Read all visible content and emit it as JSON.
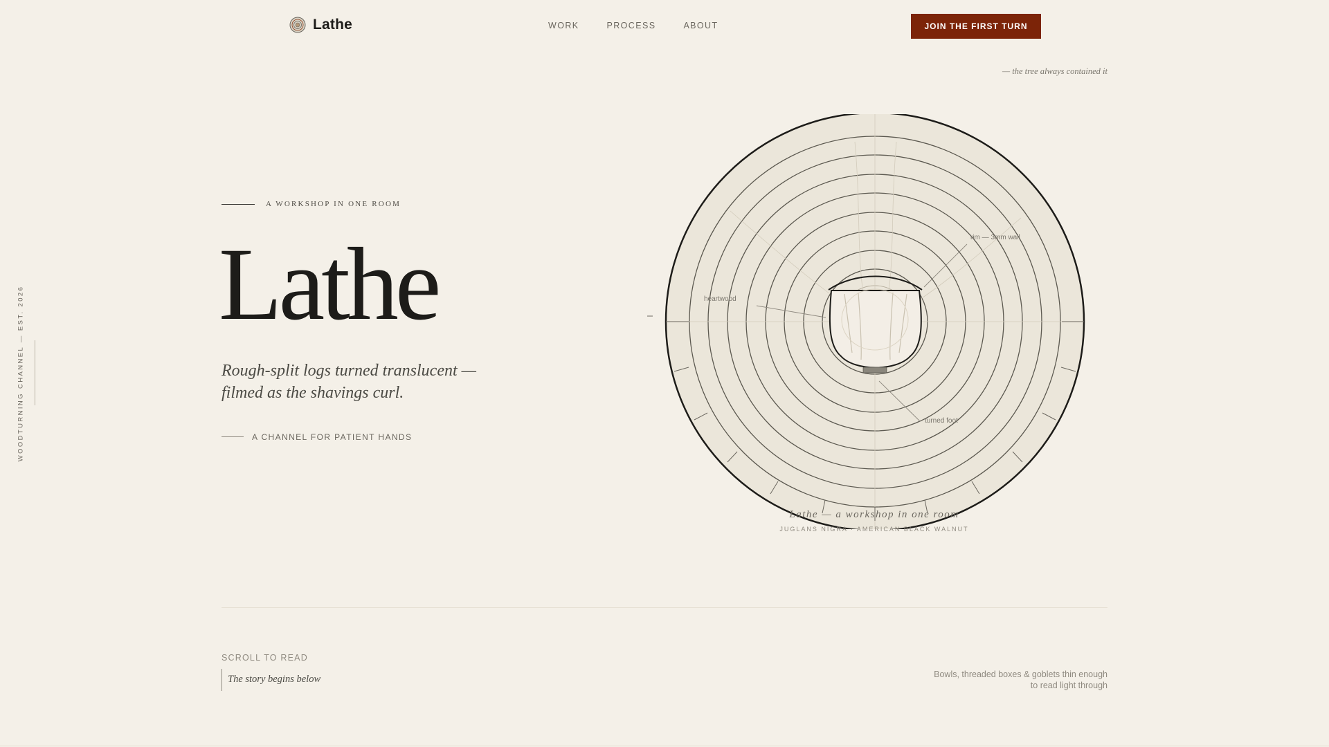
{
  "header": {
    "brand": "Lathe",
    "nav": [
      "WORK",
      "PROCESS",
      "ABOUT"
    ],
    "cta": "JOIN THE FIRST TURN"
  },
  "side_label": "WOODTURNING CHANNEL — EST. 2026",
  "hero": {
    "eyebrow": "A WORKSHOP IN ONE ROOM",
    "title": "Lathe",
    "subtitle_line1": "Rough-split logs turned translucent —",
    "subtitle_line2": "filmed as the shavings curl.",
    "tagline": "A CHANNEL FOR PATIENT HANDS"
  },
  "illustration": {
    "quote": "— the tree always contained it",
    "labels": {
      "rim": "rim — 3mm wall",
      "heartwood": "heartwood",
      "foot": "turned foot"
    },
    "caption": "Lathe — a workshop in one room",
    "species": "JUGLANS NIGRA · AMERICAN BLACK WALNUT"
  },
  "lower": {
    "scroll_label": "SCROLL TO READ",
    "story": "The story begins below",
    "description_line1": "Bowls, threaded boxes & goblets thin enough",
    "description_line2": "to read light through"
  },
  "colors": {
    "background": "#f4f0e8",
    "ink": "#1d1c19",
    "accent": "#7c2408",
    "wood": "#ebe6da"
  }
}
